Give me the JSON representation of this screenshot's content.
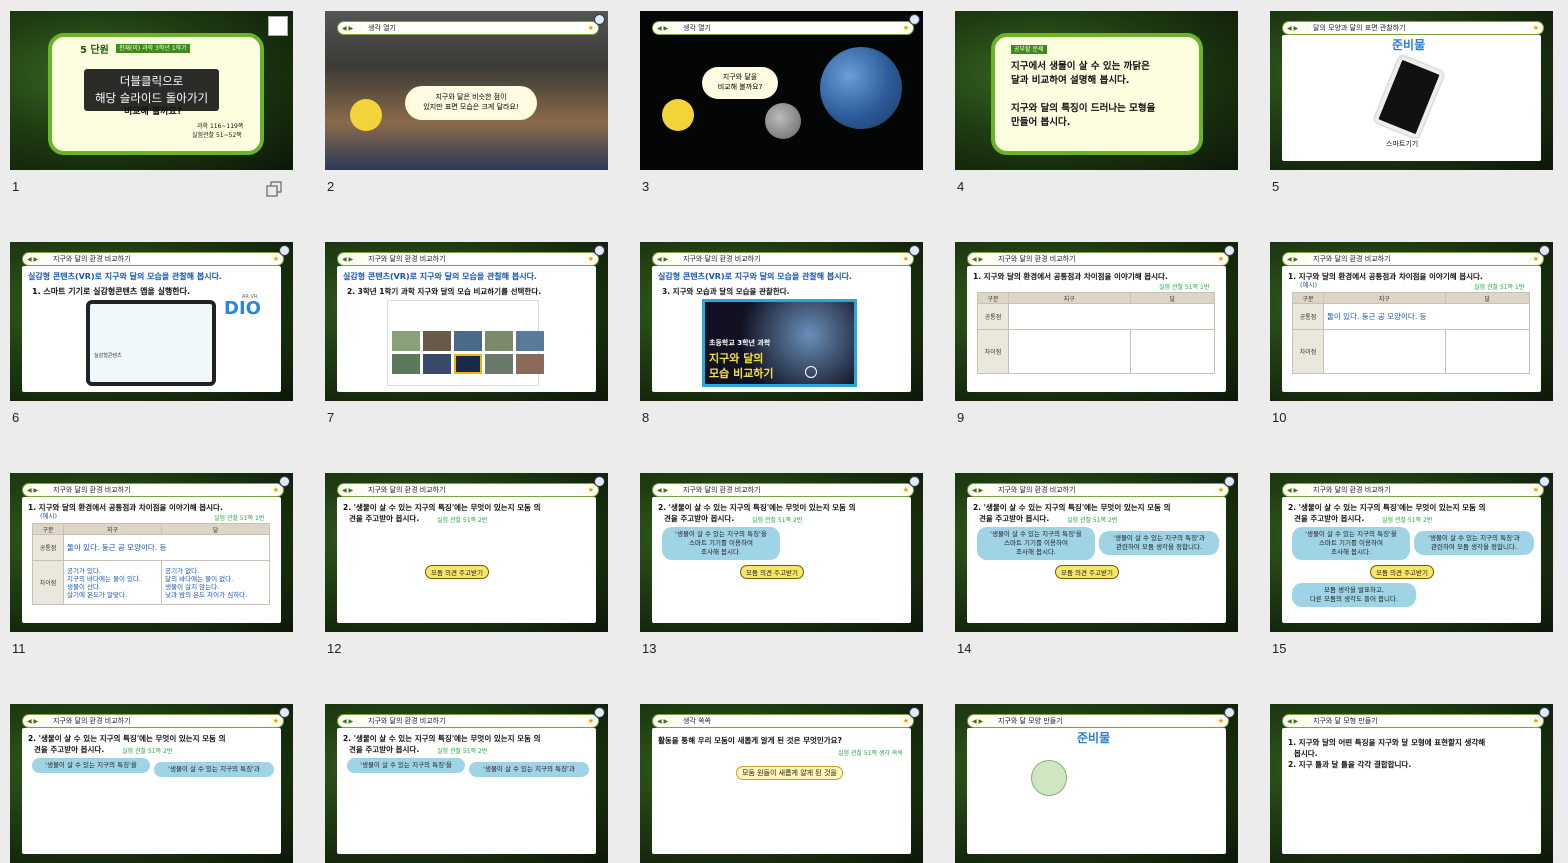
{
  "overlay_text": [
    "더블클릭으로",
    "해당 슬라이드 돌아가기"
  ],
  "slides": [
    {
      "num": "1",
      "unit": "5 단원",
      "tag": "천재(이) 과학 3학년 1학기",
      "q": "비교해 볼까요?",
      "pages": [
        "과학 116~119쪽",
        "실험관찰 51~52쪽"
      ]
    },
    {
      "num": "2",
      "title": "생각 열기",
      "bubble": [
        "지구와 달은 비슷한 점이",
        "있지만 표면 모습은 크게 달라요!"
      ]
    },
    {
      "num": "3",
      "title": "생각 열기",
      "bubble": [
        "지구와 달을",
        "비교해 볼까요?"
      ]
    },
    {
      "num": "4",
      "badge": "공부할 문제",
      "lines": [
        "지구에서 생물이 살 수 있는 까닭은",
        "달과 비교하여 설명해 봅시다.",
        "",
        "지구와 달의 특징이 드러나는 모형을",
        "만들어 봅시다."
      ]
    },
    {
      "num": "5",
      "title": "달의 모양과 달의 표면 관찰하기",
      "heading": "준비물",
      "caption": "스마트기기"
    },
    {
      "num": "6",
      "title": "지구와 달의 환경 비교하기",
      "line1": "실감형 콘텐츠(VR)로 지구와 달의 모습을 관찰해 봅시다.",
      "line2": "1. 스마트 기기로 실감형콘텐츠 앱을 실행한다.",
      "app": "실감형콘텐츠",
      "ar": "AR VR"
    },
    {
      "num": "7",
      "title": "지구와 달의 환경 비교하기",
      "line1": "실감형 콘텐츠(VR)로 지구와 달의 모습을 관찰해 봅시다.",
      "line2": "2. 3학년 1학기 과학 지구와 달의 모습 비교하기를 선택한다."
    },
    {
      "num": "8",
      "title": "지구와 달의 환경 비교하기",
      "line1": "실감형 콘텐츠(VR)로 지구와 달의 모습을 관찰해 봅시다.",
      "line2": "3. 지구와 모습과 달의 모습을 관찰한다.",
      "video": [
        "초등학교 3학년 과학",
        "지구와 달의",
        "모습 비교하기"
      ]
    },
    {
      "num": "9",
      "title": "지구와 달의 환경 비교하기",
      "line1": "1. 지구와 달의 환경에서 공통점과 차이점을 이야기해 봅시다.",
      "ref": "실험 관찰 51쪽 1번",
      "cols": [
        "구분",
        "지구",
        "달"
      ],
      "rows": [
        "공통점",
        "차이점"
      ]
    },
    {
      "num": "10",
      "title": "지구와 달의 환경 비교하기",
      "line1": "1. 지구와 달의 환경에서 공통점과 차이점을 이야기해 봅시다.",
      "ex": "(예시)",
      "ref": "실험 관찰 51쪽 1번",
      "cols": [
        "구분",
        "지구",
        "달"
      ],
      "rows": [
        "공통점",
        "차이점"
      ],
      "common": "둘이 있다. 둥근 공 모양이다. 등"
    },
    {
      "num": "11",
      "title": "지구와 달의 환경 비교하기",
      "line1": "1. 지구와 달의 환경에서 공통점과 차이점을 이야기해 봅시다.",
      "ex": "(예시)",
      "ref": "실험 관찰 51쪽 1번",
      "cols": [
        "구분",
        "지구",
        "달"
      ],
      "rows": [
        "공통점",
        "차이점"
      ],
      "common": "둘이 있다. 둥근 공 모양이다. 등",
      "earth": [
        "공기가 있다.",
        "지구의 바다에는 물이 있다.",
        "생물이 산다.",
        "살기에 온도가 알맞다."
      ],
      "moon": [
        "공기가 없다.",
        "달의 바다에는 물이 없다.",
        "생물이 살지 않는다.",
        "낮과 밤의 온도 차이가 심하다."
      ]
    },
    {
      "num": "12",
      "title": "지구와 달의 환경 비교하기",
      "q1": "2. '생물이 살 수 있는 지구의 특징'에는 무엇이 있는지 모둠 의",
      "q2": "견을 주고받아 봅시다.",
      "ref": "실험 관찰 51쪽 2번",
      "pill": "모둠 의견 주고받기"
    },
    {
      "num": "13",
      "title": "지구와 달의 환경 비교하기",
      "q1": "2. '생물이 살 수 있는 지구의 특징'에는 무엇이 있는지 모둠 의",
      "q2": "견을 주고받아 봅시다.",
      "ref": "실험 관찰 51쪽 2번",
      "pill": "모둠 의견 주고받기",
      "b1": [
        "'생물이 살 수 있는 지구의 특징'을",
        "스마트 기기를 이용하여",
        "조사해 봅시다."
      ]
    },
    {
      "num": "14",
      "title": "지구와 달의 환경 비교하기",
      "q1": "2. '생물이 살 수 있는 지구의 특징'에는 무엇이 있는지 모둠 의",
      "q2": "견을 주고받아 봅시다.",
      "ref": "실험 관찰 51쪽 2번",
      "pill": "모둠 의견 주고받기",
      "b1": [
        "'생물이 살 수 있는 지구의 특징'을",
        "스마트 기기를 이용하여",
        "조사해 봅시다."
      ],
      "b2": [
        "'생물이 살 수 있는 지구의 특징'과",
        "관련하여 모둠 생각을 정합니다."
      ]
    },
    {
      "num": "15",
      "title": "지구와 달의 환경 비교하기",
      "q1": "2. '생물이 살 수 있는 지구의 특징'에는 무엇이 있는지 모둠 의",
      "q2": "견을 주고받아 봅시다.",
      "ref": "실험 관찰 51쪽 2번",
      "pill": "모둠 의견 주고받기",
      "b1": [
        "'생물이 살 수 있는 지구의 특징'을",
        "스마트 기기를 이용하여",
        "조사해 봅시다."
      ],
      "b2": [
        "'생물이 살 수 있는 지구의 특징'과",
        "관련하여 모둠 생각을 정합니다."
      ],
      "b3": [
        "모둠 생각을 발표하고,",
        "다른 모둠의 생각도 들어 봅니다."
      ]
    },
    {
      "num": "16",
      "title": "지구와 달의 환경 비교하기",
      "q1": "2. '생물이 살 수 있는 지구의 특징'에는 무엇이 있는지 모둠 의",
      "q2": "견을 주고받아 봅시다.",
      "ref": "실험 관찰 51쪽 2번",
      "b1": "'생물이 살 수 있는 지구의 특징'을",
      "b2": "'생물이 살 수 있는 지구의 특징'과"
    },
    {
      "num": "17",
      "title": "지구와 달의 환경 비교하기",
      "q1": "2. '생물이 살 수 있는 지구의 특징'에는 무엇이 있는지 모둠 의",
      "q2": "견을 주고받아 봅시다.",
      "ref": "실험 관찰 51쪽 2번",
      "b1": "'생물이 살 수 있는 지구의 특징'을",
      "b2": "'생물이 살 수 있는 지구의 특징'과"
    },
    {
      "num": "18",
      "title": "생각 쏙쏙",
      "q1": "활동을 통해 우리 모둠이 새롭게 알게 된 것은 무엇인가요?",
      "ref": "실험 관찰 51쪽 생각 쏙쏙",
      "bubble": "모둠 원들이 새롭게 알게 된 것을"
    },
    {
      "num": "19",
      "title": "지구와 달 모양 만들기",
      "heading": "준비물"
    },
    {
      "num": "20",
      "title": "지구와 달 모형 만들기",
      "l1": "1. 지구와 달의 어떤 특징을 지구와 달 모형에 표현할지 생각해",
      "l2": "봅시다.",
      "l3": "2. 지구 틀과 달 틀을 각각 결합합니다."
    }
  ]
}
